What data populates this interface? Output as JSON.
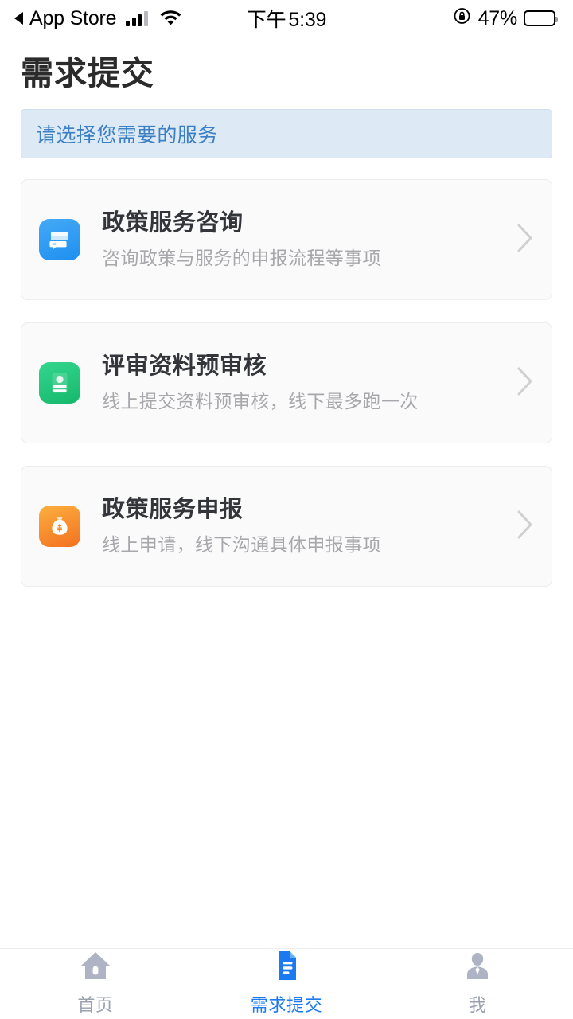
{
  "status_bar": {
    "back_label": "App Store",
    "back_icon": "back-caret-icon",
    "signal_icon": "signal-bars-icon",
    "wifi_icon": "wifi-icon",
    "time_ampm": "下午",
    "time_value": "5:39",
    "rotation_lock_icon": "rotation-lock-icon",
    "battery_percent": "47%",
    "battery_level": 47,
    "battery_icon": "battery-icon"
  },
  "header": {
    "title": "需求提交"
  },
  "notice": {
    "text": "请选择您需要的服务",
    "bg_color": "#dde9f4",
    "text_color": "#3b7fc4"
  },
  "services": [
    {
      "title": "政策服务咨询",
      "subtitle": "咨询政策与服务的申报流程等事项",
      "icon_name": "chat-bubble-icon",
      "icon_color": "#2196f3",
      "icon_color_end": "#45a9f7",
      "chevron_icon": "chevron-right-icon"
    },
    {
      "title": "评审资料预审核",
      "subtitle": "线上提交资料预审核，线下最多跑一次",
      "icon_name": "id-card-person-icon",
      "icon_color": "#23c37a",
      "icon_color_end": "#2fd08a",
      "chevron_icon": "chevron-right-icon"
    },
    {
      "title": "政策服务申报",
      "subtitle": "线上申请，线下沟通具体申报事项",
      "icon_name": "money-bag-icon",
      "icon_color": "#f7a93c",
      "icon_color_end": "#f47b20",
      "chevron_icon": "chevron-right-icon"
    }
  ],
  "tab_bar": {
    "active_color": "#1b7af0",
    "inactive_color": "#9aa0b0",
    "items": [
      {
        "label": "首页",
        "icon_name": "home-icon",
        "active": false
      },
      {
        "label": "需求提交",
        "icon_name": "document-icon",
        "active": true
      },
      {
        "label": "我",
        "icon_name": "person-icon",
        "active": false
      }
    ]
  }
}
